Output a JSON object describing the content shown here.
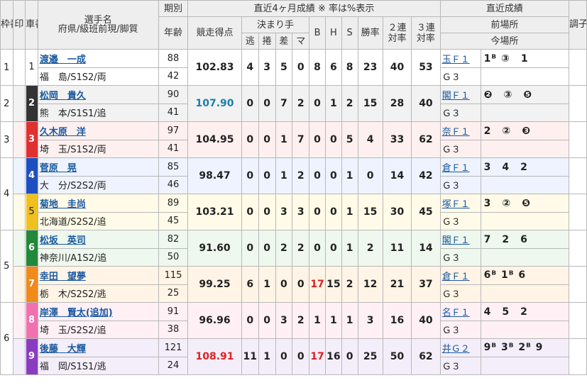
{
  "header": {
    "waku": "枠番",
    "shirushi": "印",
    "sha": "車番",
    "player_top": "選手名",
    "player_bottom": "府県/級班前現/脚質",
    "ki": "期別",
    "age": "年齢",
    "stats_title": "直近4ヶ月成績 ※ 率は%表示",
    "score": "競走得点",
    "kimarite": "決まり手",
    "nige": "逃",
    "makuri": "捲",
    "sashi": "差",
    "mark": "マ",
    "b": "B",
    "h": "H",
    "s": "S",
    "win": "勝率",
    "ren2": "２連対率",
    "ren3": "３連対率",
    "recent_title": "直近成績",
    "prev": "前場所",
    "now": "今場所",
    "cho": "調子"
  },
  "rows": [
    {
      "waku": "1",
      "sha": "1",
      "name": "渡邉　一成",
      "pref": "福　島/S1S2/両",
      "ki": "88",
      "age": "42",
      "score": "102.83",
      "nige": "4",
      "makuri": "3",
      "sashi": "5",
      "mark": "0",
      "b": "8",
      "h": "6",
      "s": "8",
      "win": "23",
      "r2": "40",
      "r3": "53",
      "venue": "玉Ｆ１",
      "result": "1ᴮ ③　1",
      "grade": "Ｇ３"
    },
    {
      "waku": "2",
      "sha": "2",
      "name": "松岡　貴久",
      "pref": "熊　本/S1S1/追",
      "ki": "90",
      "age": "41",
      "score": "107.90",
      "nige": "0",
      "makuri": "0",
      "sashi": "7",
      "mark": "2",
      "b": "0",
      "h": "1",
      "s": "2",
      "win": "15",
      "r2": "28",
      "r3": "40",
      "venue": "閣Ｆ１",
      "result": "❷　③　❺",
      "grade": "Ｇ３"
    },
    {
      "waku": "3",
      "sha": "3",
      "name": "久木原　洋",
      "pref": "埼　玉/S1S2/両",
      "ki": "97",
      "age": "41",
      "score": "104.95",
      "nige": "0",
      "makuri": "0",
      "sashi": "1",
      "mark": "7",
      "b": "0",
      "h": "0",
      "s": "5",
      "win": "4",
      "r2": "33",
      "r3": "62",
      "venue": "奈Ｆ１",
      "result": "2　②　❸",
      "grade": "Ｇ３"
    },
    {
      "waku": "4",
      "sha": "4",
      "name": "菅原　晃",
      "pref": "大　分/S2S2/両",
      "ki": "85",
      "age": "46",
      "score": "98.47",
      "nige": "0",
      "makuri": "0",
      "sashi": "1",
      "mark": "2",
      "b": "0",
      "h": "0",
      "s": "1",
      "win": "0",
      "r2": "14",
      "r3": "42",
      "venue": "倉Ｆ１",
      "result": "3　4　2",
      "grade": "Ｇ３"
    },
    {
      "waku": "4",
      "sha": "5",
      "name": "菊地　圭尚",
      "pref": "北海道/S2S2/追",
      "ki": "89",
      "age": "45",
      "score": "103.21",
      "nige": "0",
      "makuri": "0",
      "sashi": "3",
      "mark": "3",
      "b": "0",
      "h": "0",
      "s": "1",
      "win": "15",
      "r2": "30",
      "r3": "45",
      "venue": "塚Ｆ１",
      "result": "3　②　❺",
      "grade": "Ｇ３"
    },
    {
      "waku": "5",
      "sha": "6",
      "name": "松坂　英司",
      "pref": "神奈川/A1S2/追",
      "ki": "82",
      "age": "50",
      "score": "91.60",
      "nige": "0",
      "makuri": "0",
      "sashi": "2",
      "mark": "2",
      "b": "0",
      "h": "0",
      "s": "1",
      "win": "2",
      "r2": "11",
      "r3": "14",
      "venue": "閣Ｆ１",
      "result": "7　2　6",
      "grade": "Ｇ３"
    },
    {
      "waku": "5",
      "sha": "7",
      "name": "幸田　望夢",
      "pref": "栃　木/S2S2/逃",
      "ki": "115",
      "age": "25",
      "score": "99.25",
      "nige": "6",
      "makuri": "1",
      "sashi": "0",
      "mark": "0",
      "b": "17",
      "h": "15",
      "s": "2",
      "win": "12",
      "r2": "21",
      "r3": "37",
      "venue": "倉Ｆ１",
      "result": "6ᴮ 1ᴮ 6",
      "grade": "Ｇ３"
    },
    {
      "waku": "6",
      "sha": "8",
      "name": "岸澤　賢太(追加)",
      "pref": "埼　玉/S2S2/追",
      "ki": "91",
      "age": "38",
      "score": "96.96",
      "nige": "0",
      "makuri": "0",
      "sashi": "3",
      "mark": "2",
      "b": "1",
      "h": "1",
      "s": "1",
      "win": "3",
      "r2": "16",
      "r3": "40",
      "venue": "名Ｆ１",
      "result": "4　5　2",
      "grade": "Ｇ３"
    },
    {
      "waku": "6",
      "sha": "9",
      "name": "後藤　大輝",
      "pref": "福　岡/S1S1/逃",
      "ki": "121",
      "age": "24",
      "score": "108.91",
      "nige": "11",
      "makuri": "1",
      "sashi": "0",
      "mark": "0",
      "b": "17",
      "h": "16",
      "s": "0",
      "win": "25",
      "r2": "50",
      "r3": "62",
      "venue": "井Ｇ２",
      "result": "9ᴮ 3ᴮ 2ᴮ 9",
      "grade": "Ｇ３"
    }
  ],
  "colors": {
    "car1_bg": "#ffffff",
    "car2_bg": "#333333",
    "car3_bg": "#e03030",
    "car4_bg": "#1d4fc0",
    "car5_bg": "#f0c020",
    "car6_bg": "#22883a",
    "car7_bg": "#f08a1a",
    "car8_bg": "#f070b0",
    "car9_bg": "#8a3cc0",
    "row1": "#ffffff",
    "row2": "#f2f2f2",
    "row3": "#fff0f0",
    "row4": "#eef3ff",
    "row5": "#fffbe8",
    "row6": "#eef8ee",
    "row7": "#fff4e6",
    "row8": "#fff0f6",
    "row9": "#f4eefa",
    "blue_score": "#1a7fa8",
    "red_score": "#e02020"
  }
}
